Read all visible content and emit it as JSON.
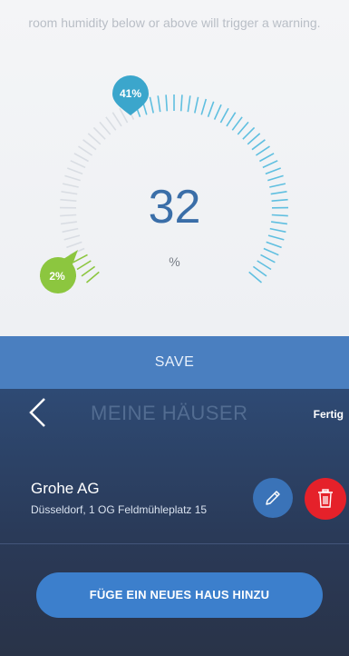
{
  "humidity": {
    "intro_text": "room humidity below or above will trigger a warning.",
    "current_value": "32",
    "unit": "%",
    "max_marker_label": "41%",
    "min_marker_label": "2%",
    "max_threshold_percent": 41,
    "min_threshold_percent": 2,
    "colors": {
      "value": "#3a6ea8",
      "max_marker": "#3ba6cc",
      "min_marker": "#8cc63f",
      "tick_active": "#5fbfe0",
      "tick_inactive": "#d9dde3"
    }
  },
  "save_bar": {
    "label": "SAVE"
  },
  "houses": {
    "nav_title": "MEINE HÄUSER",
    "done_label": "Fertig",
    "items": [
      {
        "name": "Grohe AG",
        "address": "Düsseldorf, 1 OG Feldmühleplatz 15"
      }
    ],
    "add_button_label": "FÜGE EIN NEUES HAUS HINZU",
    "icons": {
      "back": "chevron-left-icon",
      "edit": "pencil-icon",
      "delete": "trash-icon"
    }
  }
}
